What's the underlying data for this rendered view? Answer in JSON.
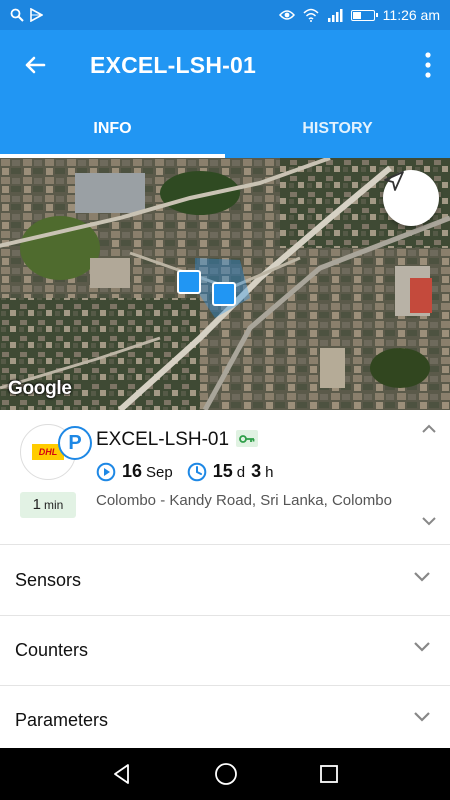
{
  "status_bar": {
    "time": "11:26 am",
    "left_icons": [
      "search-icon",
      "play-store-icon"
    ],
    "right_icons": [
      "eye-icon",
      "wifi-icon",
      "signal-icon",
      "battery-icon"
    ]
  },
  "app_bar": {
    "title": "EXCEL-LSH-01",
    "back_icon": "arrow-left-icon",
    "menu_icon": "more-vert-icon"
  },
  "tabs": [
    {
      "label": "INFO",
      "active": true
    },
    {
      "label": "HISTORY",
      "active": false
    }
  ],
  "map": {
    "attribution": "Google",
    "locate_icon": "navigation-arrow-icon"
  },
  "object": {
    "name": "EXCEL-LSH-01",
    "logo_text": "DHL",
    "status_letter": "P",
    "duration_value": "1",
    "duration_unit": "min",
    "date_day": "16",
    "date_month": "Sep",
    "time_days": "15",
    "time_days_unit": "d",
    "time_hours": "3",
    "time_hours_unit": "h",
    "address": "Colombo - Kandy Road, Sri Lanka, Colombo"
  },
  "sections": [
    {
      "label": "Sensors"
    },
    {
      "label": "Counters"
    },
    {
      "label": "Parameters"
    }
  ],
  "colors": {
    "status_bar": "#1d86e0",
    "app_bar": "#2196f3",
    "accent": "#1e88e5",
    "chip_green": "#e2f2e4"
  }
}
